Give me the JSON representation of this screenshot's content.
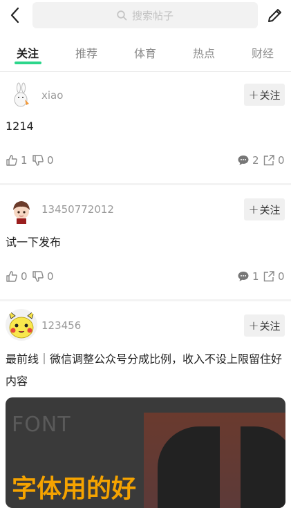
{
  "header": {
    "search_placeholder": "搜索帖子"
  },
  "tabs": [
    {
      "label": "关注",
      "active": true
    },
    {
      "label": "推荐",
      "active": false
    },
    {
      "label": "体育",
      "active": false
    },
    {
      "label": "热点",
      "active": false
    },
    {
      "label": "财经",
      "active": false
    }
  ],
  "accent_color": "#2cd68b",
  "follow_label": "关注",
  "posts": [
    {
      "username": "xiao",
      "text": "1214",
      "likes": "1",
      "dislikes": "0",
      "comments": "2",
      "shares": "0"
    },
    {
      "username": "13450772012",
      "text": "试一下发布",
      "likes": "0",
      "dislikes": "0",
      "comments": "1",
      "shares": "0"
    },
    {
      "username": "123456",
      "text": "最前线｜微信调整公众号分成比例，收入不设上限留住好内容",
      "image_text_1": "FONT",
      "image_text_2": "字体用的好"
    }
  ]
}
